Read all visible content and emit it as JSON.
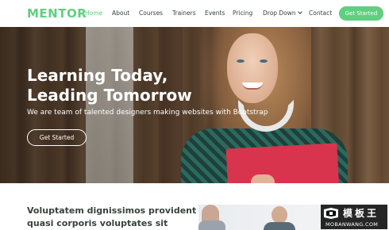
{
  "header": {
    "logo": "MENTOR",
    "nav": {
      "home": "Home",
      "about": "About",
      "courses": "Courses",
      "trainers": "Trainers",
      "events": "Events",
      "pricing": "Pricing",
      "dropdown": "Drop Down",
      "contact": "Contact"
    },
    "cta": "Get Started"
  },
  "hero": {
    "title_line1": "Learning Today,",
    "title_line2": "Leading Tomorrow",
    "subtitle": "We are team of talented designers making websites with Bootstrap",
    "cta": "Get Started"
  },
  "about": {
    "line1": "Voluptatem dignissimos provident",
    "line2": "quasi corporis voluptates sit"
  },
  "watermark": {
    "brand": "模板王",
    "url": "MOBANWANG.COM"
  },
  "colors": {
    "accent": "#5fcf80",
    "text": "#37423b"
  }
}
